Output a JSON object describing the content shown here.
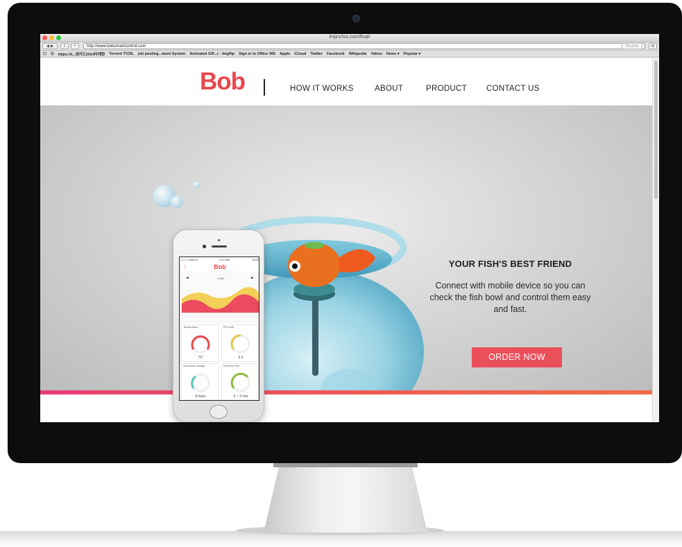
{
  "colors": {
    "brand": "#e8474d",
    "cta": "#ea4f5a",
    "stripe_start": "#e83d75",
    "stripe_end": "#f06d45",
    "bezel": "#0d0d0e"
  },
  "browser": {
    "window_title": "imjinchoi.com/final/",
    "url": "http://www.bobsmartcontrol.com",
    "reader_label": "Reader",
    "bookmarks": [
      "https://t...성카드2014마케팅",
      "Torrent TVZIL",
      "job posting...ment System",
      "Animated GIF...r - Imgflip",
      "Sign in to Office 365",
      "Apple",
      "iCloud",
      "Twitter",
      "Facebook",
      "Wikipedia",
      "Yahoo",
      "News",
      "Popular"
    ]
  },
  "site": {
    "logo": "Bob",
    "nav": [
      "HOW IT WORKS",
      "ABOUT",
      "PRODUCT",
      "CONTACT US"
    ],
    "headline": "YOUR FISH'S BEST FRIEND",
    "subtext": "Connect with mobile device so you can check the fish bowl and control them easy and fast.",
    "cta": "ORDER NOW"
  },
  "phone": {
    "status_left": "••○○○ Search",
    "status_time": "9:41 AM",
    "status_right": "100%",
    "app_logo": "Bob",
    "chart_month": "JUNE",
    "cards": [
      {
        "title": "Temperature",
        "value": "72°",
        "color": "#e8474d"
      },
      {
        "title": "Pill Level",
        "value": "6.3",
        "color": "#e6c54a"
      },
      {
        "title": "Next water change",
        "value": "8 days",
        "color": "#56c5b8"
      },
      {
        "title": "Feeding Time",
        "value": "6 ~ 3 min",
        "color": "#8cbf3f"
      }
    ]
  }
}
